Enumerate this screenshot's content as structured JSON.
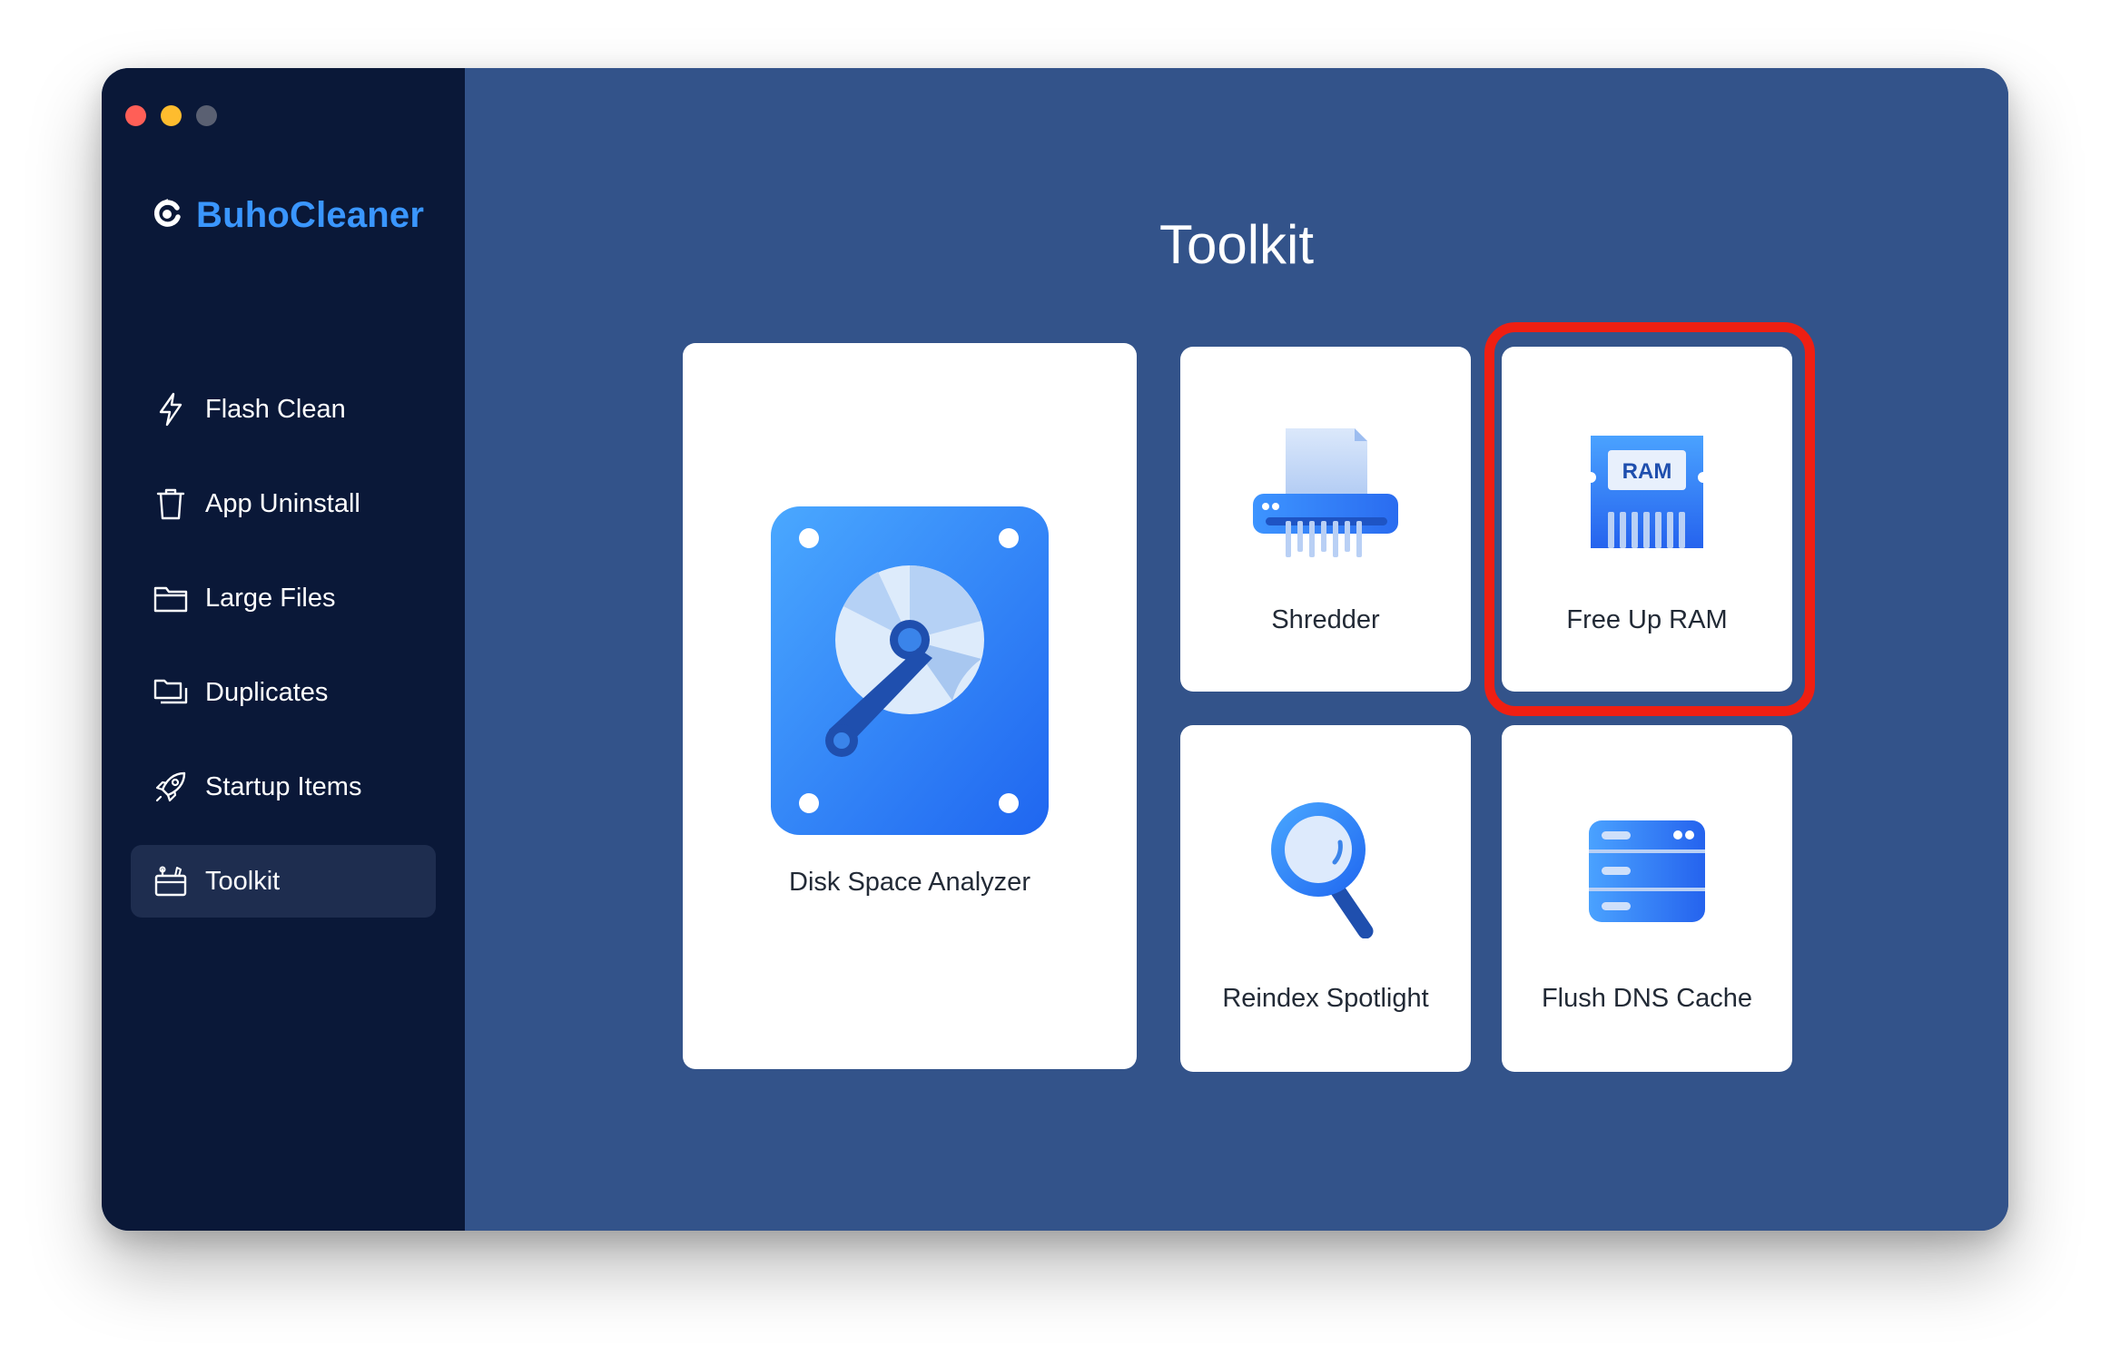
{
  "window": {
    "traffic_lights": {
      "close_color": "#ff5f57",
      "minimize_color": "#febc2e",
      "zoom_color": "#5a6072"
    }
  },
  "sidebar": {
    "brand": {
      "name": "BuhoCleaner",
      "icon": "buho-logo-icon",
      "color": "#3a96ff"
    },
    "items": [
      {
        "label": "Flash Clean",
        "icon": "lightning-icon",
        "active": false
      },
      {
        "label": "App Uninstall",
        "icon": "trash-icon",
        "active": false
      },
      {
        "label": "Large Files",
        "icon": "folder-icon",
        "active": false
      },
      {
        "label": "Duplicates",
        "icon": "duplicate-folder-icon",
        "active": false
      },
      {
        "label": "Startup Items",
        "icon": "rocket-icon",
        "active": false
      },
      {
        "label": "Toolkit",
        "icon": "toolbox-icon",
        "active": true
      }
    ]
  },
  "main": {
    "title": "Toolkit",
    "tools": [
      {
        "label": "Disk Space Analyzer",
        "icon": "hard-disk-icon"
      },
      {
        "label": "Shredder",
        "icon": "shredder-icon"
      },
      {
        "label": "Free Up RAM",
        "icon": "ram-chip-icon",
        "chip_text": "RAM",
        "highlighted": true
      },
      {
        "label": "Reindex Spotlight",
        "icon": "magnifier-icon"
      },
      {
        "label": "Flush DNS Cache",
        "icon": "server-icon"
      }
    ],
    "highlight_color": "#ef1f12"
  }
}
